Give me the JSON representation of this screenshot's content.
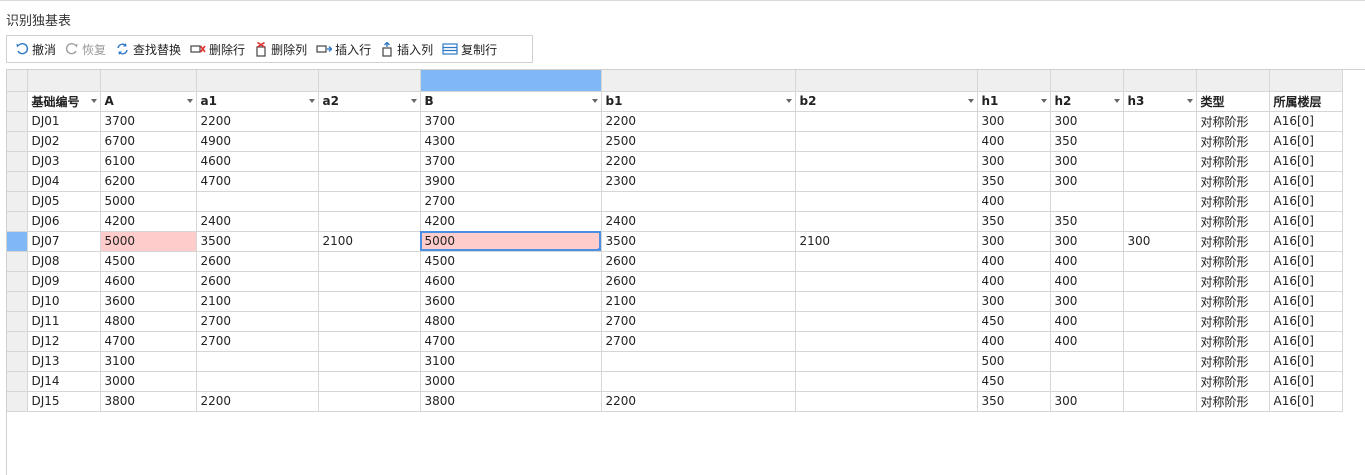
{
  "title": "识别独基表",
  "toolbar": {
    "undo": "撤消",
    "redo": "恢复",
    "find_replace": "查找替换",
    "delete_row": "删除行",
    "delete_col": "删除列",
    "insert_row": "插入行",
    "insert_col": "插入列",
    "copy_row": "复制行"
  },
  "icons": [
    "undo-icon",
    "redo-icon",
    "find-replace-icon",
    "delete-row-icon",
    "delete-column-icon",
    "insert-row-icon",
    "insert-column-icon",
    "copy-row-icon",
    "dropdown-arrow-icon"
  ],
  "colors": {
    "selection": "#7fb8f5",
    "highlight": "#ffcccc",
    "active_border": "#4a90e2"
  },
  "grid": {
    "headers": [
      "基础编号",
      "A",
      "a1",
      "a2",
      "B",
      "b1",
      "b2",
      "h1",
      "h2",
      "h3",
      "类型",
      "所属楼层"
    ],
    "rows": [
      [
        "DJ01",
        "3700",
        "2200",
        "",
        "3700",
        "2200",
        "",
        "300",
        "300",
        "",
        "对称阶形",
        "A16[0]"
      ],
      [
        "DJ02",
        "6700",
        "4900",
        "",
        "4300",
        "2500",
        "",
        "400",
        "350",
        "",
        "对称阶形",
        "A16[0]"
      ],
      [
        "DJ03",
        "6100",
        "4600",
        "",
        "3700",
        "2200",
        "",
        "300",
        "300",
        "",
        "对称阶形",
        "A16[0]"
      ],
      [
        "DJ04",
        "6200",
        "4700",
        "",
        "3900",
        "2300",
        "",
        "350",
        "300",
        "",
        "对称阶形",
        "A16[0]"
      ],
      [
        "DJ05",
        "5000",
        "",
        "",
        "2700",
        "",
        "",
        "400",
        "",
        "",
        "对称阶形",
        "A16[0]"
      ],
      [
        "DJ06",
        "4200",
        "2400",
        "",
        "4200",
        "2400",
        "",
        "350",
        "350",
        "",
        "对称阶形",
        "A16[0]"
      ],
      [
        "DJ07",
        "5000",
        "3500",
        "2100",
        "5000",
        "3500",
        "2100",
        "300",
        "300",
        "300",
        "对称阶形",
        "A16[0]"
      ],
      [
        "DJ08",
        "4500",
        "2600",
        "",
        "4500",
        "2600",
        "",
        "400",
        "400",
        "",
        "对称阶形",
        "A16[0]"
      ],
      [
        "DJ09",
        "4600",
        "2600",
        "",
        "4600",
        "2600",
        "",
        "400",
        "400",
        "",
        "对称阶形",
        "A16[0]"
      ],
      [
        "DJ10",
        "3600",
        "2100",
        "",
        "3600",
        "2100",
        "",
        "300",
        "300",
        "",
        "对称阶形",
        "A16[0]"
      ],
      [
        "DJ11",
        "4800",
        "2700",
        "",
        "4800",
        "2700",
        "",
        "450",
        "400",
        "",
        "对称阶形",
        "A16[0]"
      ],
      [
        "DJ12",
        "4700",
        "2700",
        "",
        "4700",
        "2700",
        "",
        "400",
        "400",
        "",
        "对称阶形",
        "A16[0]"
      ],
      [
        "DJ13",
        "3100",
        "",
        "",
        "3100",
        "",
        "",
        "500",
        "",
        "",
        "对称阶形",
        "A16[0]"
      ],
      [
        "DJ14",
        "3000",
        "",
        "",
        "3000",
        "",
        "",
        "450",
        "",
        "",
        "对称阶形",
        "A16[0]"
      ],
      [
        "DJ15",
        "3800",
        "2200",
        "",
        "3800",
        "2200",
        "",
        "350",
        "300",
        "",
        "对称阶形",
        "A16[0]"
      ]
    ]
  }
}
